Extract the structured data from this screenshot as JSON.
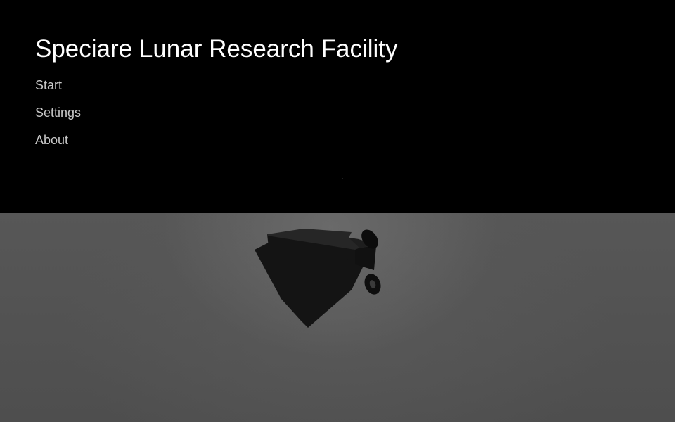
{
  "game": {
    "title": "Speciare Lunar Research Facility"
  },
  "menu": {
    "items": [
      {
        "label": "Start"
      },
      {
        "label": "Settings"
      },
      {
        "label": "About"
      }
    ]
  },
  "colors": {
    "sky": "#000000",
    "ground": "#555555",
    "title_text": "#ffffff",
    "menu_text": "#c8c8c8"
  }
}
